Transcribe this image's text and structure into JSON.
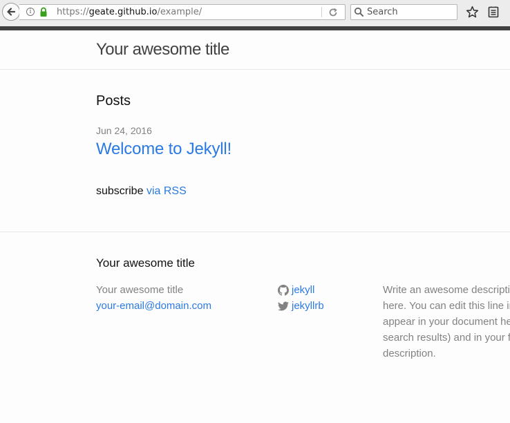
{
  "browser": {
    "url_scheme": "https://",
    "url_host": "geate.github.io",
    "url_path": "/example/",
    "search_placeholder": "Search"
  },
  "site": {
    "title": "Your awesome title"
  },
  "main": {
    "posts_heading": "Posts",
    "posts": [
      {
        "date": "Jun 24, 2016",
        "title": "Welcome to Jekyll!"
      }
    ],
    "subscribe_text": "subscribe",
    "rss_link": "via RSS"
  },
  "footer": {
    "heading": "Your awesome title",
    "name": "Your awesome title",
    "email": "your-email@domain.com",
    "github_user": "jekyll",
    "twitter_user": "jekyllrb",
    "description_lines": [
      "Write an awesome descriptio",
      "here. You can edit this line in",
      "appear in your document hea",
      "search results) and in your fe",
      "description."
    ]
  },
  "colors": {
    "link": "#2a7ae2",
    "meta_text": "#828282",
    "lock_green": "#3c9f1f"
  },
  "icons": {
    "back": "back-arrow-icon",
    "info": "info-icon",
    "lock": "lock-icon",
    "reload": "reload-icon",
    "search": "search-icon",
    "bookmark": "star-icon",
    "reader": "reading-list-icon",
    "github": "github-icon",
    "twitter": "twitter-icon"
  }
}
